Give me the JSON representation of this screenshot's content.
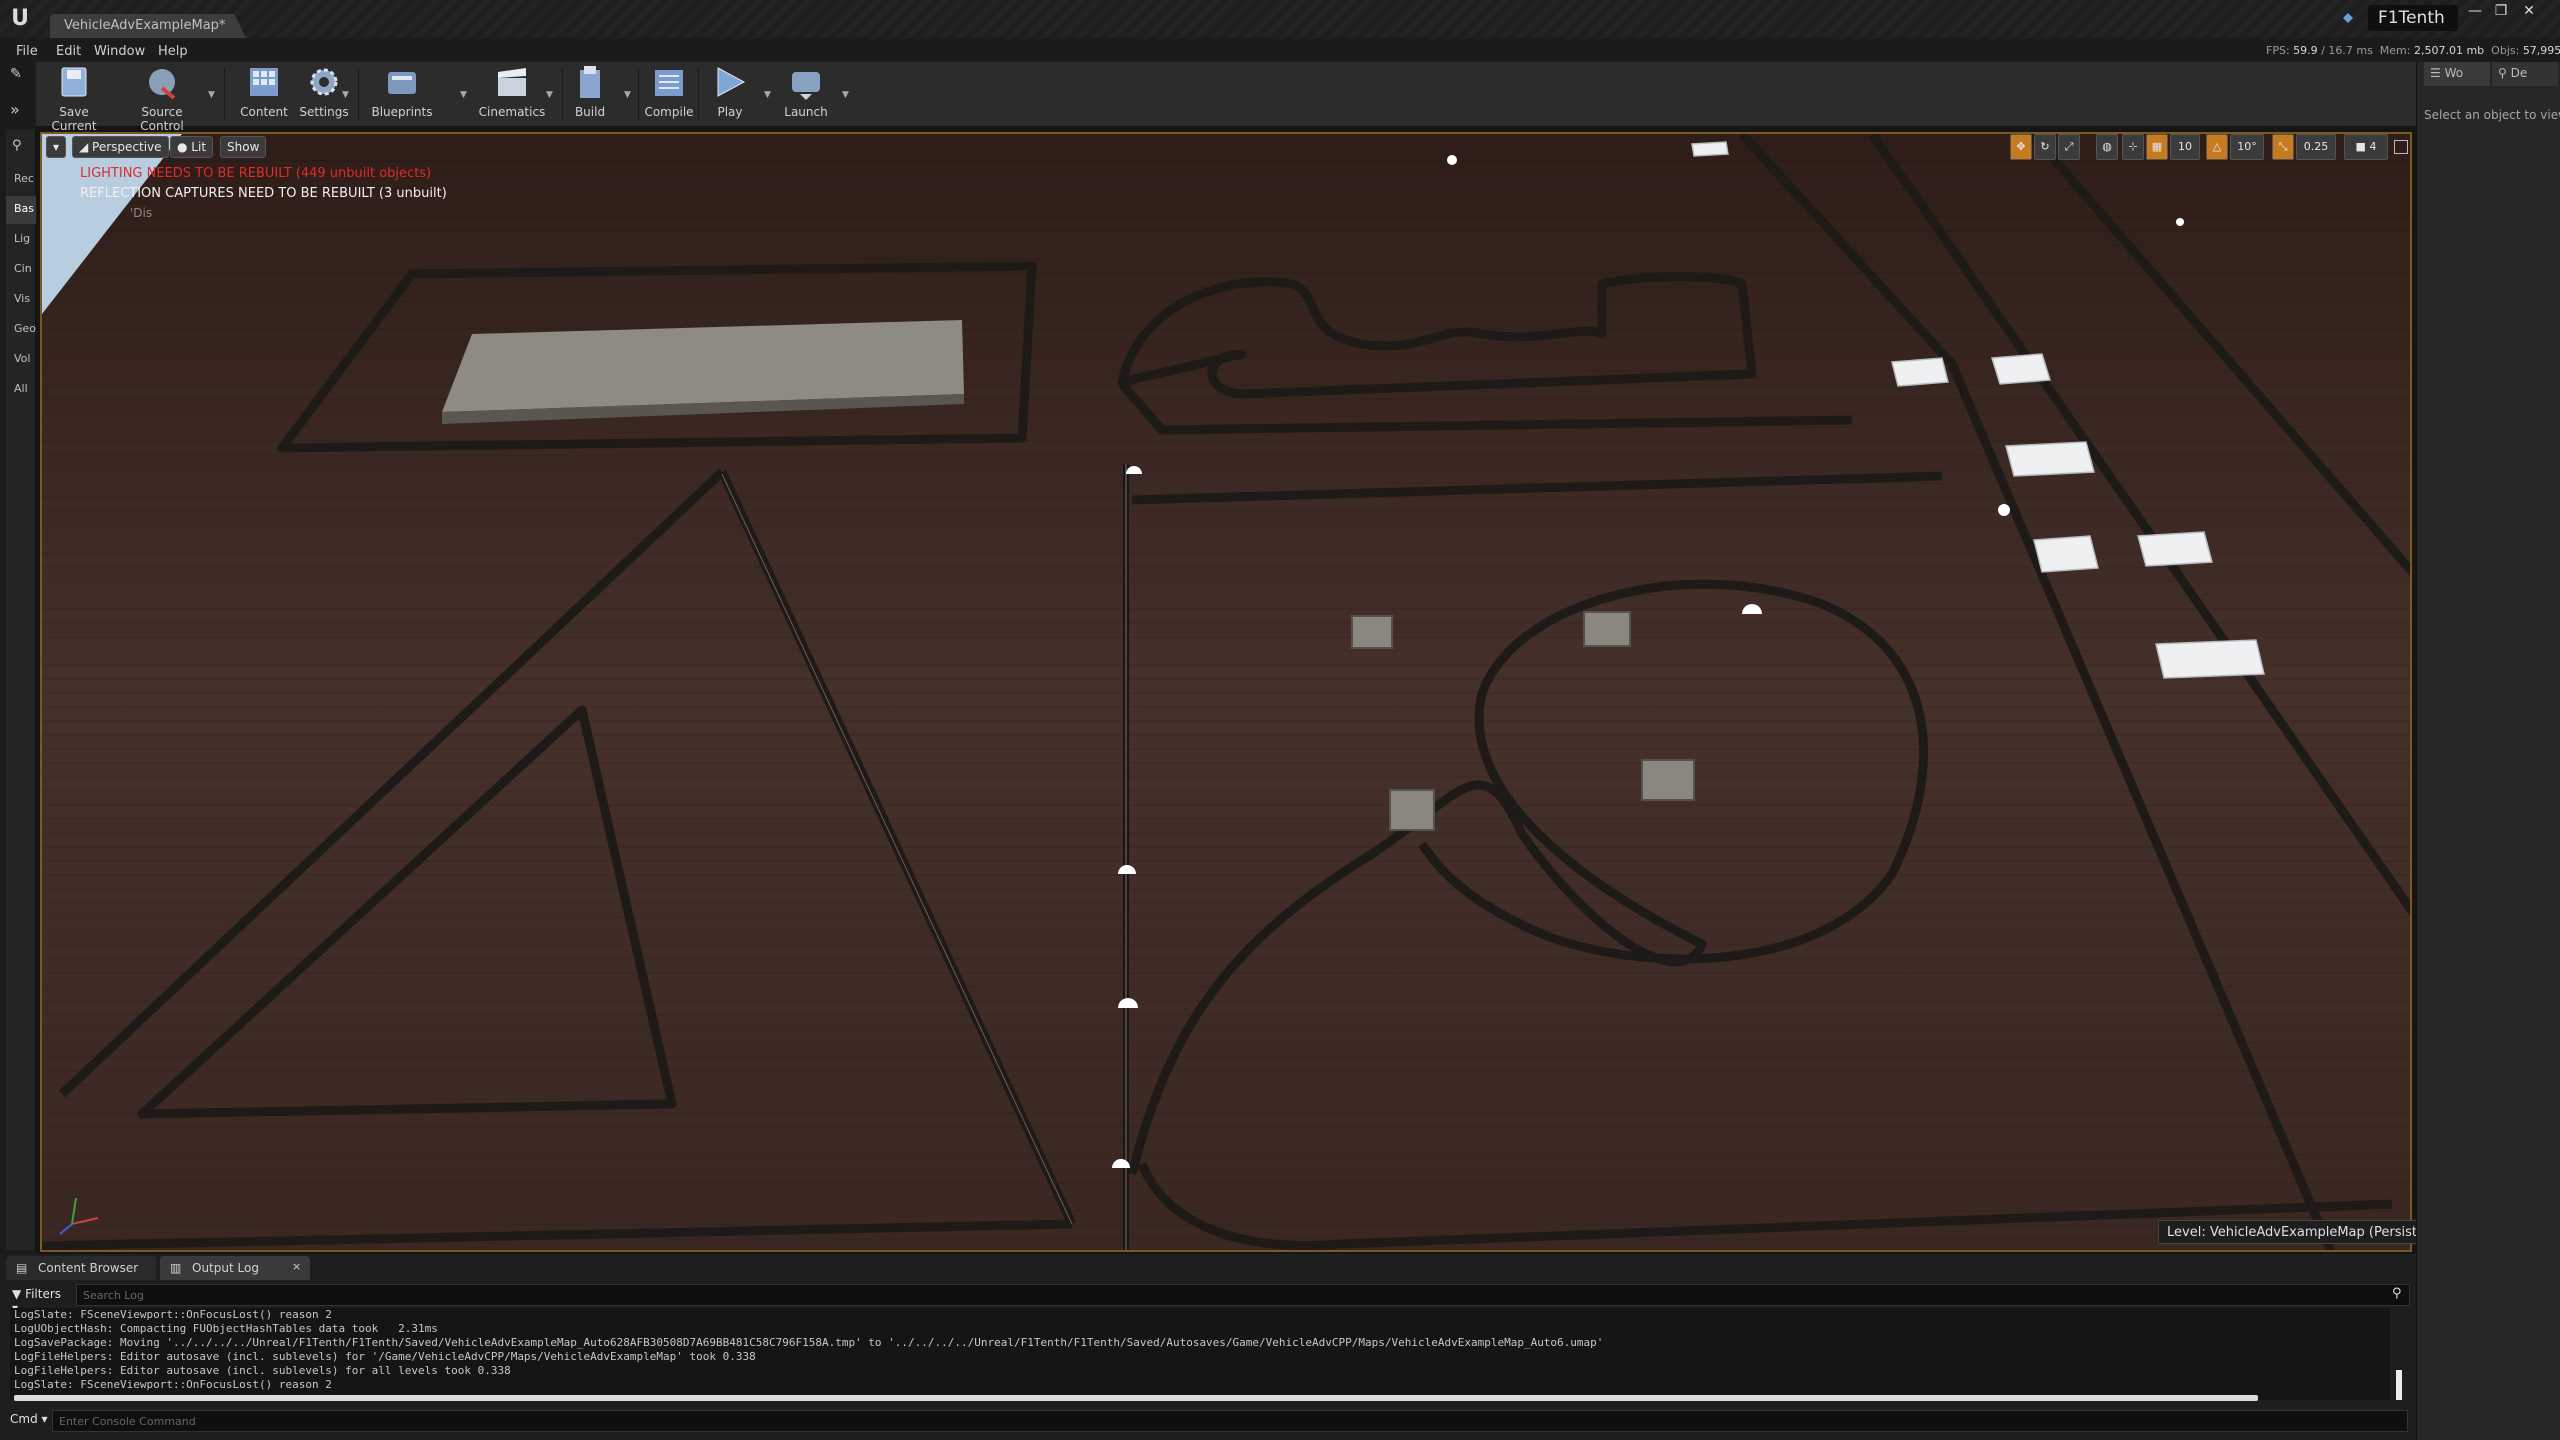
{
  "window": {
    "tab_title": "VehicleAdvExampleMap*",
    "project": "F1Tenth",
    "buttons": [
      "—",
      "❐",
      "✕"
    ]
  },
  "menu": [
    "File",
    "Edit",
    "Window",
    "Help"
  ],
  "stats": {
    "fps_label": "FPS:",
    "fps": "59.9",
    "ms": "/ 16.7 ms",
    "mem_label": "Mem:",
    "mem": "2,507.01 mb",
    "objs_label": "Objs:",
    "objs": "57,995"
  },
  "toolbar": [
    {
      "label": "Save Current",
      "icon": "save-icon"
    },
    {
      "label": "Source Control",
      "icon": "source-control-icon"
    },
    {
      "label": "Content",
      "icon": "content-icon"
    },
    {
      "label": "Settings",
      "icon": "settings-icon"
    },
    {
      "label": "Blueprints",
      "icon": "blueprints-icon"
    },
    {
      "label": "Cinematics",
      "icon": "cinematics-icon"
    },
    {
      "label": "Build",
      "icon": "build-icon"
    },
    {
      "label": "Compile",
      "icon": "compile-icon"
    },
    {
      "label": "Play",
      "icon": "play-icon"
    },
    {
      "label": "Launch",
      "icon": "launch-icon"
    }
  ],
  "modes": [
    "Rec",
    "Bas",
    "Lig",
    "Cin",
    "Vis",
    "Geo",
    "Vol",
    "All"
  ],
  "viewport": {
    "perspective": "Perspective",
    "lit": "Lit",
    "show": "Show",
    "warning_lighting": "LIGHTING NEEDS TO BE REBUILT (449 unbuilt objects)",
    "warning_reflection": "REFLECTION CAPTURES NEED TO BE REBUILT (3 unbuilt)",
    "warning_faded": "'Dis",
    "grid_snap": "10",
    "rot_snap": "10°",
    "scale_snap": "0.25",
    "cam_speed": "4",
    "level_prefix": "Level:",
    "level_name": "VehicleAdvExampleMap (Persistent)"
  },
  "right_panel": {
    "tabs": [
      "Wo",
      "De"
    ],
    "message": "Select an object to view"
  },
  "bottom": {
    "tabs": [
      "Content Browser",
      "Output Log"
    ],
    "filters": "Filters",
    "search_placeholder": "Search Log",
    "log": [
      "LogSlate: FSceneViewport::OnFocusLost() reason 2",
      "LogUObjectHash: Compacting FUObjectHashTables data took   2.31ms",
      "LogSavePackage: Moving '../../../../Unreal/F1Tenth/F1Tenth/Saved/VehicleAdvExampleMap_Auto628AFB30508D7A69BB481C58C796F158A.tmp' to '../../../../Unreal/F1Tenth/F1Tenth/Saved/Autosaves/Game/VehicleAdvCPP/Maps/VehicleAdvExampleMap_Auto6.umap'",
      "LogFileHelpers: Editor autosave (incl. sublevels) for '/Game/VehicleAdvCPP/Maps/VehicleAdvExampleMap' took 0.338",
      "LogFileHelpers: Editor autosave (incl. sublevels) for all levels took 0.338",
      "LogSlate: FSceneViewport::OnFocusLost() reason 2"
    ],
    "cmd_label": "Cmd",
    "cmd_placeholder": "Enter Console Command"
  }
}
